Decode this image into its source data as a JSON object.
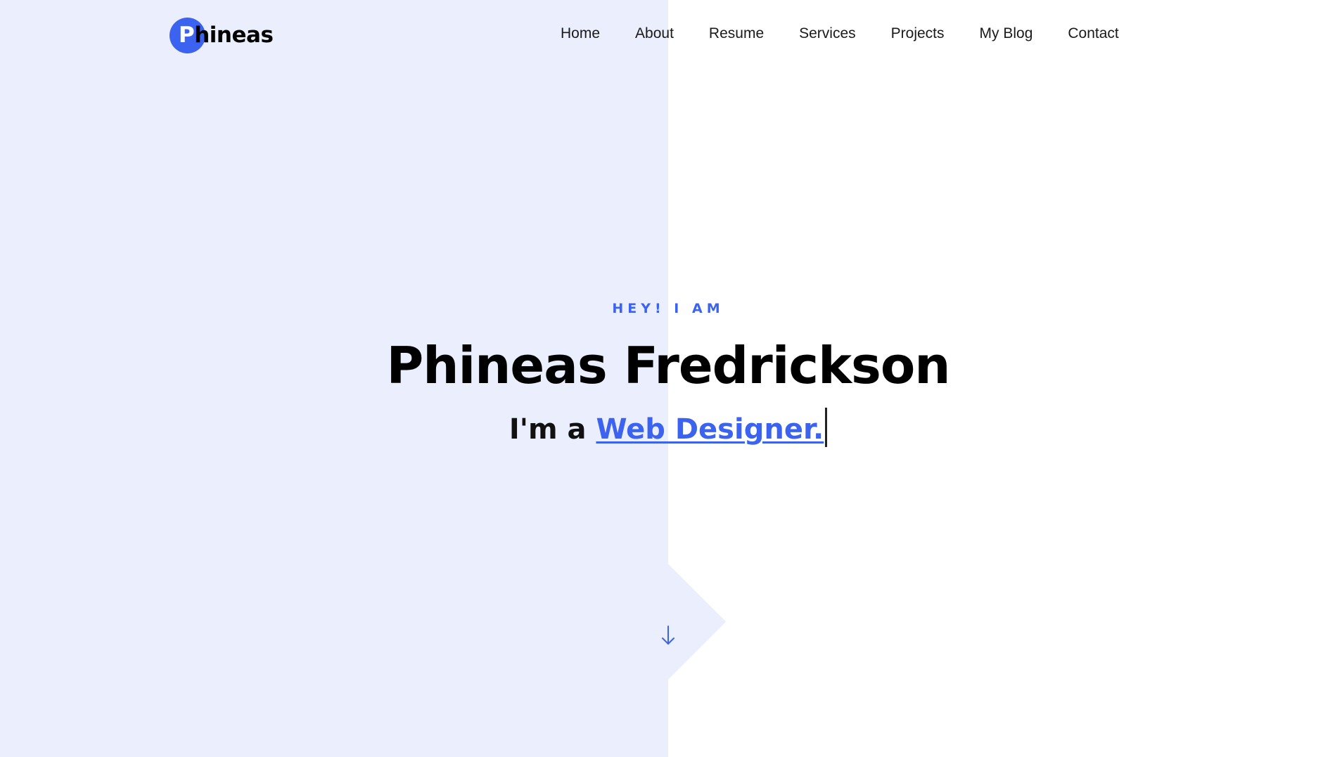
{
  "header": {
    "logo_first_letter": "P",
    "logo_rest": "hineas",
    "nav": [
      {
        "label": "Home"
      },
      {
        "label": "About"
      },
      {
        "label": "Resume"
      },
      {
        "label": "Services"
      },
      {
        "label": "Projects"
      },
      {
        "label": "My Blog"
      },
      {
        "label": "Contact"
      }
    ]
  },
  "hero": {
    "kicker": "HEY! I AM",
    "name": "Phineas Fredrickson",
    "sub_prefix": "I'm a ",
    "role": "Web Designer."
  },
  "colors": {
    "accent": "#3b63f0",
    "left_panel": "#eaeefd",
    "right_panel": "#ffffff",
    "text": "#000000"
  },
  "icons": {
    "scroll": "arrow-down-icon"
  }
}
